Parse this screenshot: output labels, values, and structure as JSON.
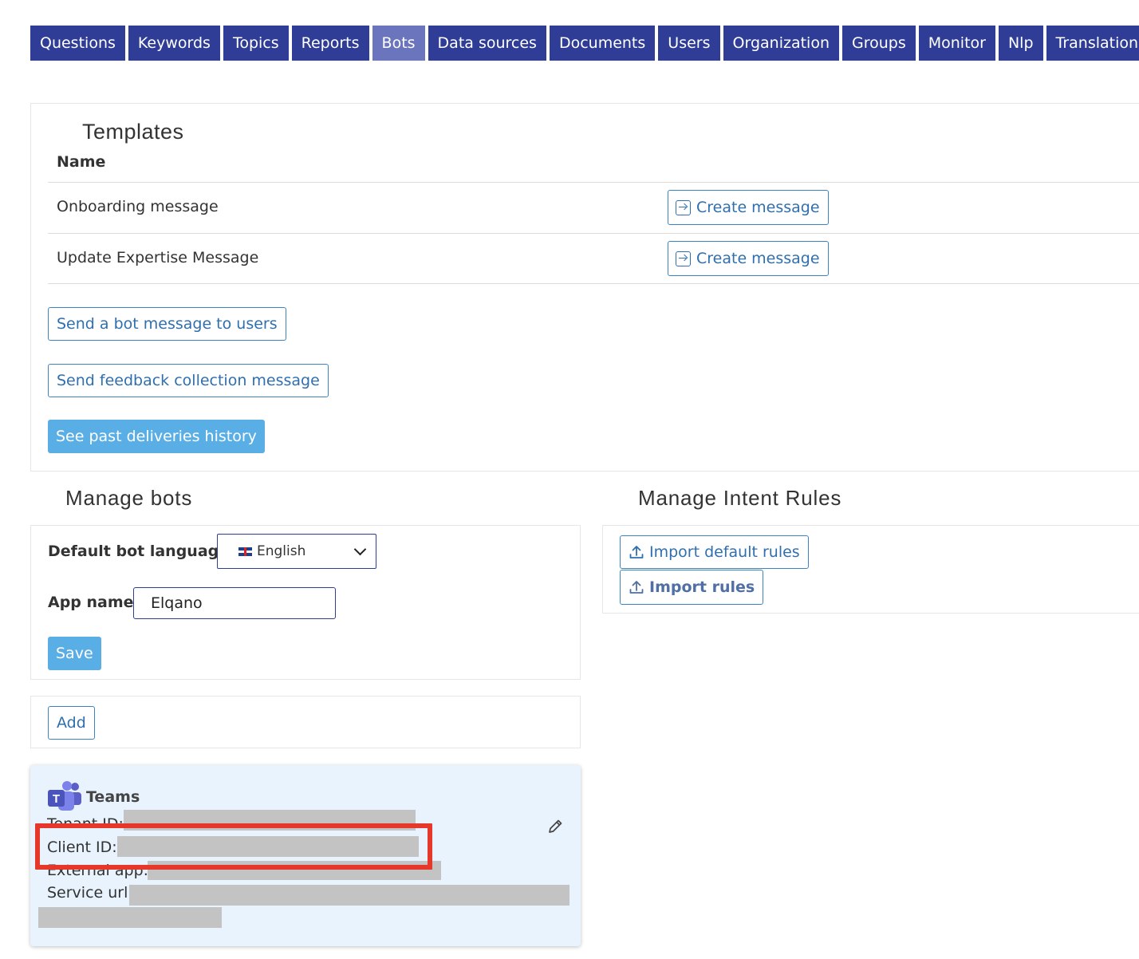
{
  "nav": {
    "tabs": [
      {
        "label": "Questions"
      },
      {
        "label": "Keywords"
      },
      {
        "label": "Topics"
      },
      {
        "label": "Reports"
      },
      {
        "label": "Bots",
        "active": true
      },
      {
        "label": "Data sources"
      },
      {
        "label": "Documents"
      },
      {
        "label": "Users"
      },
      {
        "label": "Organization"
      },
      {
        "label": "Groups"
      },
      {
        "label": "Monitor"
      },
      {
        "label": "Nlp"
      },
      {
        "label": "Translation"
      }
    ]
  },
  "templates": {
    "title": "Templates",
    "name_header": "Name",
    "rows": [
      {
        "name": "Onboarding message",
        "action": "Create message"
      },
      {
        "name": "Update Expertise Message",
        "action": "Create message"
      }
    ],
    "send_bot_message": "Send a bot message to users",
    "send_feedback": "Send feedback collection message",
    "past_deliveries": "See past deliveries history"
  },
  "manage_bots": {
    "title": "Manage bots",
    "default_language_label": "Default bot language:",
    "default_language_value": "English",
    "app_name_label": "App name:",
    "app_name_value": "Elqano",
    "save_label": "Save",
    "add_label": "Add"
  },
  "teams_card": {
    "title": "Teams",
    "tenant_label": "Tenant ID:",
    "client_label": "Client ID:",
    "external_label": "External app:",
    "service_label": "Service url:"
  },
  "intent_rules": {
    "title": "Manage Intent Rules",
    "import_default": "Import default rules",
    "import_rules": "Import rules"
  },
  "colors": {
    "nav_bg": "#2f3d96",
    "nav_active": "#6b75bd",
    "accent": "#5aaee6",
    "link": "#2f6fb0",
    "highlight": "#e5382a"
  },
  "icons": {
    "create": "arrow-into-box-icon",
    "edit": "pencil-icon",
    "import": "upload-icon",
    "teams": "microsoft-teams-icon",
    "dropdown": "chevron-down-icon",
    "language": "uk-flag-icon"
  }
}
